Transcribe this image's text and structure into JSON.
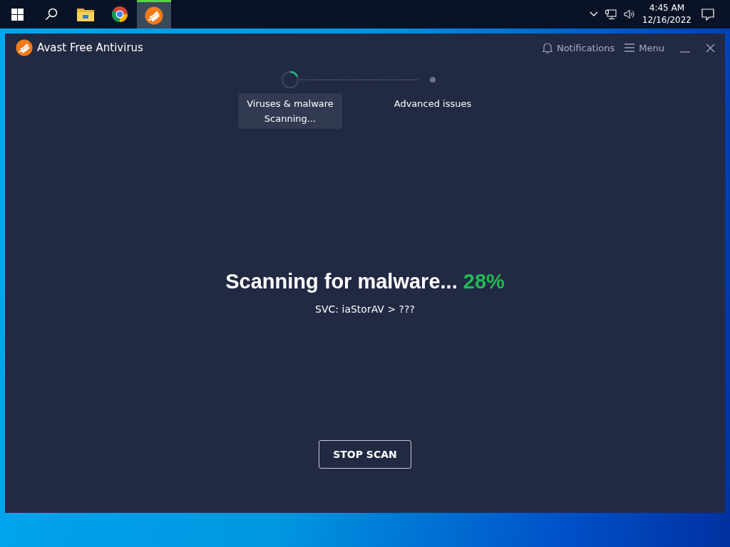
{
  "taskbar": {
    "apps": [
      {
        "kind": "explorer",
        "selected": false
      },
      {
        "kind": "chrome",
        "selected": false
      },
      {
        "kind": "avast",
        "selected": true
      }
    ],
    "time": "4:45 AM",
    "date": "12/16/2022"
  },
  "window": {
    "title": "Avast Free Antivirus",
    "notifications": "Notifications",
    "menu": "Menu"
  },
  "steps": [
    {
      "label": "Viruses & malware",
      "status": "Scanning...",
      "selected": true
    },
    {
      "label": "Advanced issues",
      "selected": false
    }
  ],
  "scan": {
    "heading": "Scanning for malware...",
    "percent": "28%",
    "detail": "SVC: iaStorAV > ???",
    "button": "STOP SCAN"
  }
}
